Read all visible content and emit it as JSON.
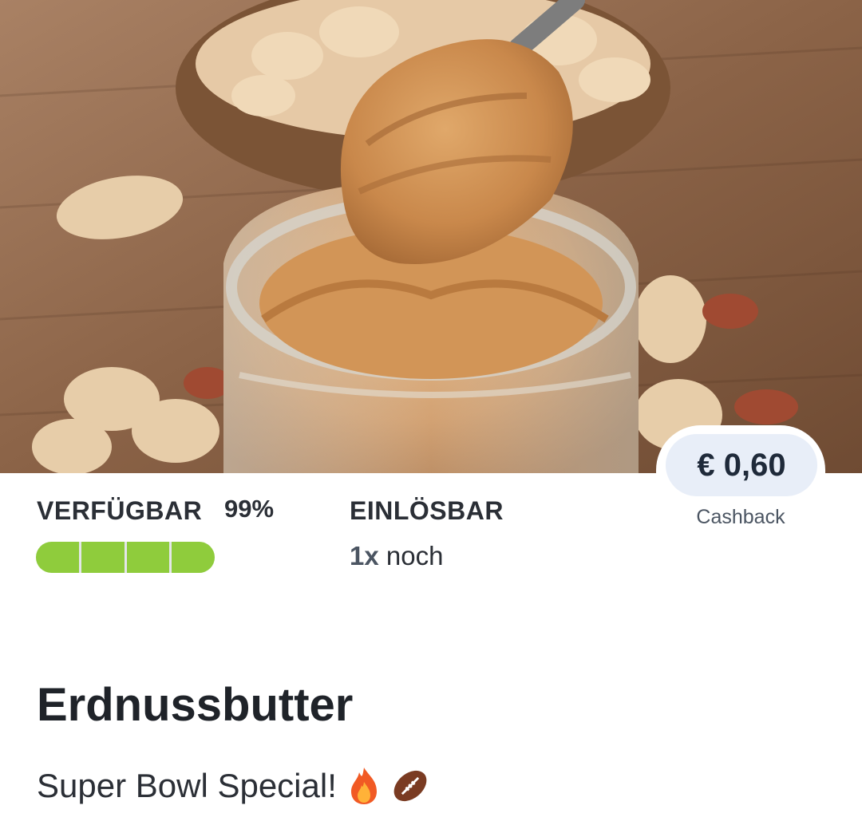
{
  "offer": {
    "price": "€ 0,60",
    "price_caption": "Cashback",
    "availability_label": "VERFÜGBAR",
    "availability_percent": "99%",
    "availability_fraction": 0.99,
    "redeemable_label": "EINLÖSBAR",
    "redeemable_count": "1x",
    "redeemable_suffix": "noch",
    "title": "Erdnussbutter",
    "subtitle": "Super Bowl Special!",
    "subtitle_icons": [
      "fire-icon",
      "football-icon"
    ]
  },
  "colors": {
    "progress": "#8fcc3c",
    "price_pill": "#e8eef8"
  }
}
